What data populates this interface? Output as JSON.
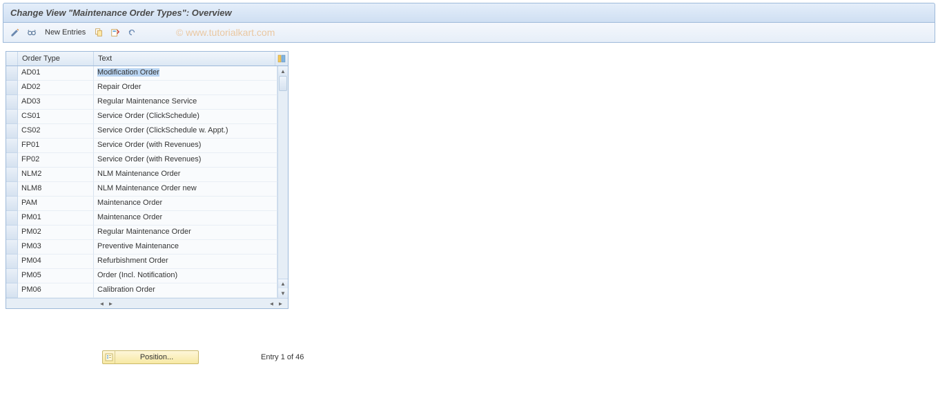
{
  "title": "Change View \"Maintenance Order Types\": Overview",
  "toolbar": {
    "new_entries": "New Entries",
    "watermark": "© www.tutorialkart.com"
  },
  "table": {
    "columns": {
      "order": "Order Type",
      "text": "Text"
    },
    "rows": [
      {
        "order": "AD01",
        "text": "Modification Order"
      },
      {
        "order": "AD02",
        "text": "Repair Order"
      },
      {
        "order": "AD03",
        "text": "Regular Maintenance Service"
      },
      {
        "order": "CS01",
        "text": "Service Order (ClickSchedule)"
      },
      {
        "order": "CS02",
        "text": "Service Order (ClickSchedule w. Appt.)"
      },
      {
        "order": "FP01",
        "text": "Service Order (with Revenues)"
      },
      {
        "order": "FP02",
        "text": "Service Order (with Revenues)"
      },
      {
        "order": "NLM2",
        "text": "NLM Maintenance Order"
      },
      {
        "order": "NLM8",
        "text": "NLM Maintenance Order new"
      },
      {
        "order": "PAM",
        "text": "Maintenance Order"
      },
      {
        "order": "PM01",
        "text": "Maintenance Order"
      },
      {
        "order": "PM02",
        "text": "Regular Maintenance Order"
      },
      {
        "order": "PM03",
        "text": "Preventive Maintenance"
      },
      {
        "order": "PM04",
        "text": "Refurbishment Order"
      },
      {
        "order": "PM05",
        "text": "Order (Incl. Notification)"
      },
      {
        "order": "PM06",
        "text": "Calibration Order"
      }
    ]
  },
  "footer": {
    "position_label": "Position...",
    "entry_text": "Entry 1 of 46"
  }
}
